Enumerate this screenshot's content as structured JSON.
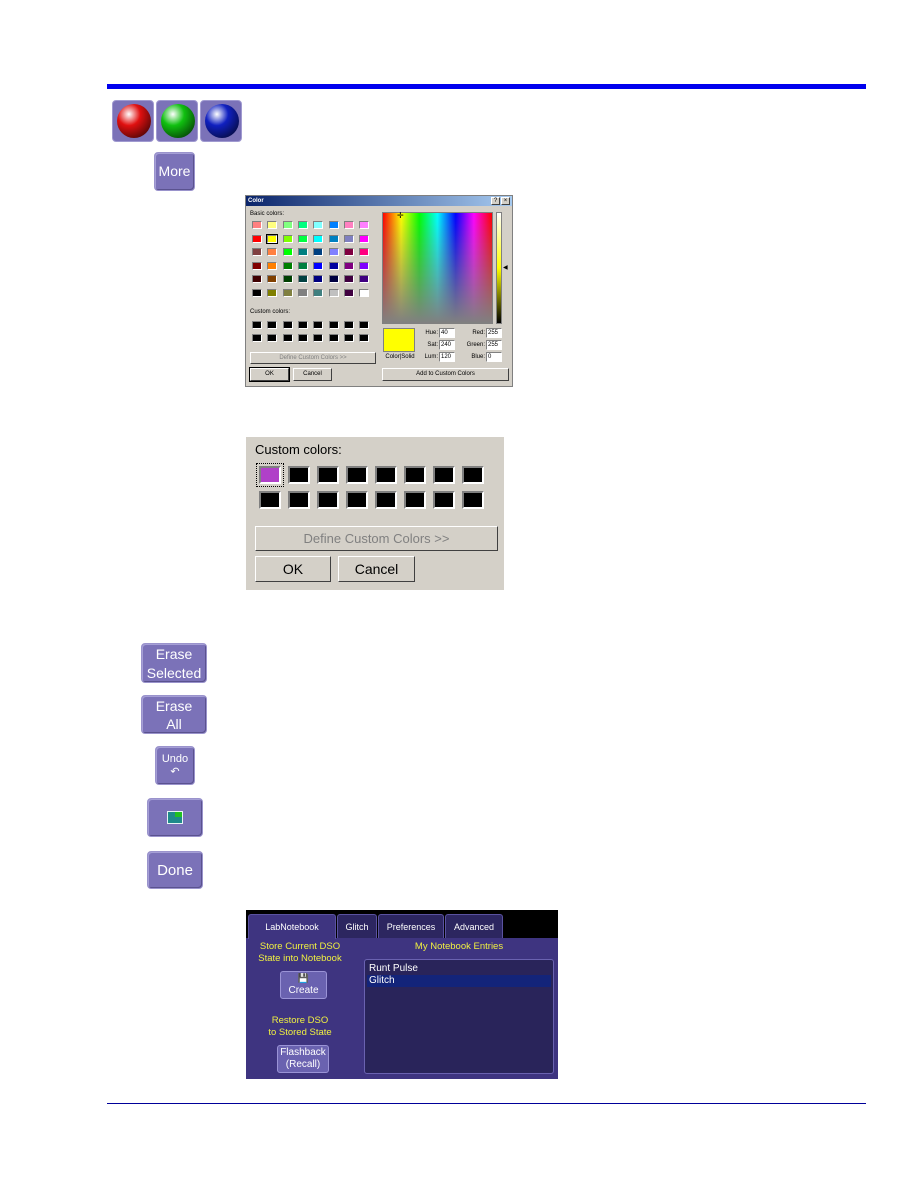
{
  "rules": {
    "top_color": "#0000ee",
    "bottom_color": "#000099"
  },
  "color_balls": [
    {
      "name": "red",
      "color": "#e01010"
    },
    {
      "name": "green",
      "color": "#10c010"
    },
    {
      "name": "blue",
      "color": "#1020c0"
    }
  ],
  "more_button": {
    "label": "More"
  },
  "color_dialog": {
    "title": "Color",
    "help_label": "?",
    "close_label": "×",
    "basic_colors_label": "Basic colors:",
    "basic_colors": [
      [
        "#ff8080",
        "#ffff80",
        "#80ff80",
        "#00ff80",
        "#80ffff",
        "#0080ff",
        "#ff80c0",
        "#ff80ff"
      ],
      [
        "#ff0000",
        "#ffff00",
        "#80ff00",
        "#00ff40",
        "#00ffff",
        "#0080c0",
        "#8080c0",
        "#ff00ff"
      ],
      [
        "#804040",
        "#ff8040",
        "#00ff00",
        "#008080",
        "#004080",
        "#8080ff",
        "#800040",
        "#ff0080"
      ],
      [
        "#800000",
        "#ff8000",
        "#008000",
        "#008040",
        "#0000ff",
        "#0000a0",
        "#800080",
        "#8000ff"
      ],
      [
        "#400000",
        "#804000",
        "#004000",
        "#004040",
        "#000080",
        "#000040",
        "#400040",
        "#400080"
      ],
      [
        "#000000",
        "#808000",
        "#808040",
        "#808080",
        "#408080",
        "#c0c0c0",
        "#400040",
        "#ffffff"
      ]
    ],
    "selected_basic": [
      1,
      1
    ],
    "custom_colors_label": "Custom colors:",
    "define_custom_label": "Define Custom Colors >>",
    "ok_label": "OK",
    "cancel_label": "Cancel",
    "color_solid_label": "Color|Solid",
    "preview_color": "#ffff00",
    "fields": {
      "hue": {
        "label": "Hue:",
        "value": "40"
      },
      "sat": {
        "label": "Sat:",
        "value": "240"
      },
      "lum": {
        "label": "Lum:",
        "value": "120"
      },
      "red": {
        "label": "Red:",
        "value": "255"
      },
      "green": {
        "label": "Green:",
        "value": "255"
      },
      "blue": {
        "label": "Blue:",
        "value": "0"
      }
    },
    "add_custom_label": "Add to Custom Colors"
  },
  "custom_detail": {
    "label": "Custom colors:",
    "first_color": "#b040c8",
    "define_custom_label": "Define Custom Colors >>",
    "ok_label": "OK",
    "cancel_label": "Cancel"
  },
  "side_buttons": {
    "erase_selected": [
      "Erase",
      "Selected"
    ],
    "erase_all": [
      "Erase",
      "All"
    ],
    "undo": [
      "Undo",
      "↶"
    ],
    "done": "Done"
  },
  "notebook": {
    "tabs": [
      "LabNotebook",
      "Glitch",
      "Preferences",
      "Advanced"
    ],
    "active_tab": 0,
    "store_label": [
      "Store Current DSO",
      "State into Notebook"
    ],
    "create_label": "Create",
    "restore_label": [
      "Restore DSO",
      "to Stored State"
    ],
    "flashback_label": [
      "Flashback",
      "(Recall)"
    ],
    "entries_title": "My Notebook Entries",
    "entries": [
      "Runt Pulse",
      "Glitch"
    ],
    "selected_entry": 1
  }
}
